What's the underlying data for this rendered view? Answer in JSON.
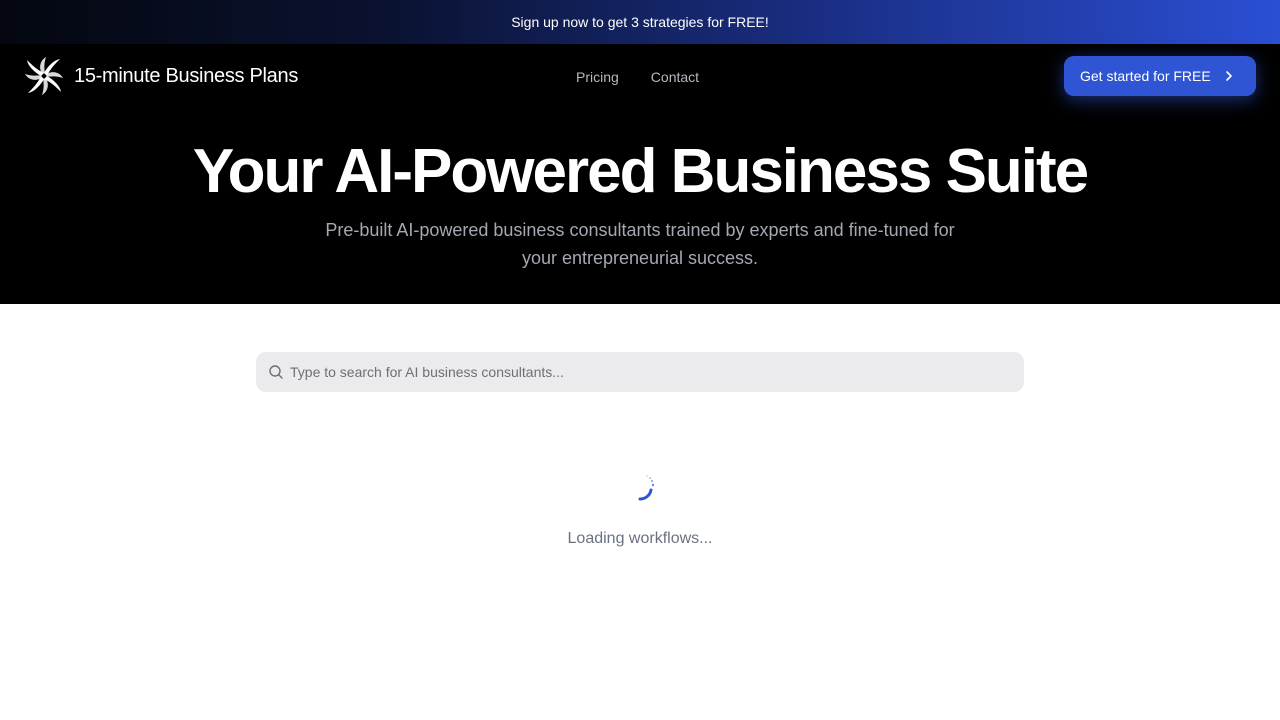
{
  "announcement": {
    "text": "Sign up now to get 3 strategies for FREE!"
  },
  "header": {
    "brand": "15-minute Business Plans",
    "nav": [
      {
        "label": "Pricing"
      },
      {
        "label": "Contact"
      }
    ],
    "cta_label": "Get started for FREE"
  },
  "hero": {
    "headline": "Your AI-Powered Business Suite",
    "subtitle": "Pre-built AI-powered business consultants trained by experts and fine-tuned for your entrepreneurial success."
  },
  "search": {
    "placeholder": "Type to search for AI business consultants...",
    "value": ""
  },
  "status": {
    "loading_text": "Loading workflows..."
  },
  "next_section": {
    "heading": ""
  },
  "icons": {
    "logo": "pinwheel-logo-icon",
    "cta": "chevron-right-icon",
    "search": "search-icon",
    "loader": "spinner-icon"
  },
  "colors": {
    "accent": "#2f55d4",
    "hero_background": "#000000",
    "banner_gradient_end": "#2b4fd4",
    "search_background": "#ebebee"
  }
}
